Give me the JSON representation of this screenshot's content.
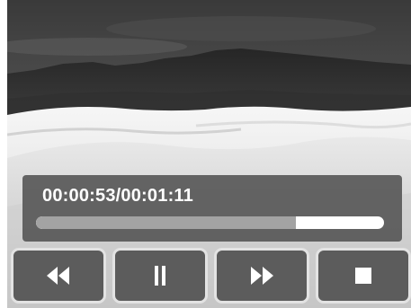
{
  "playback": {
    "time_display": "00:00:53/00:01:11",
    "progress_fraction": 0.746
  },
  "controls": [
    {
      "name": "rewind-button",
      "icon": "rewind-icon"
    },
    {
      "name": "pause-button",
      "icon": "pause-icon"
    },
    {
      "name": "fast-forward-button",
      "icon": "fast-forward-icon"
    },
    {
      "name": "stop-button",
      "icon": "stop-icon"
    }
  ],
  "colors": {
    "panel": "#585858",
    "button_face": "#5c5c5c",
    "button_border": "#e3e3e3",
    "progress_track": "#ffffff",
    "progress_fill": "#a3a3a3",
    "text": "#ffffff"
  }
}
